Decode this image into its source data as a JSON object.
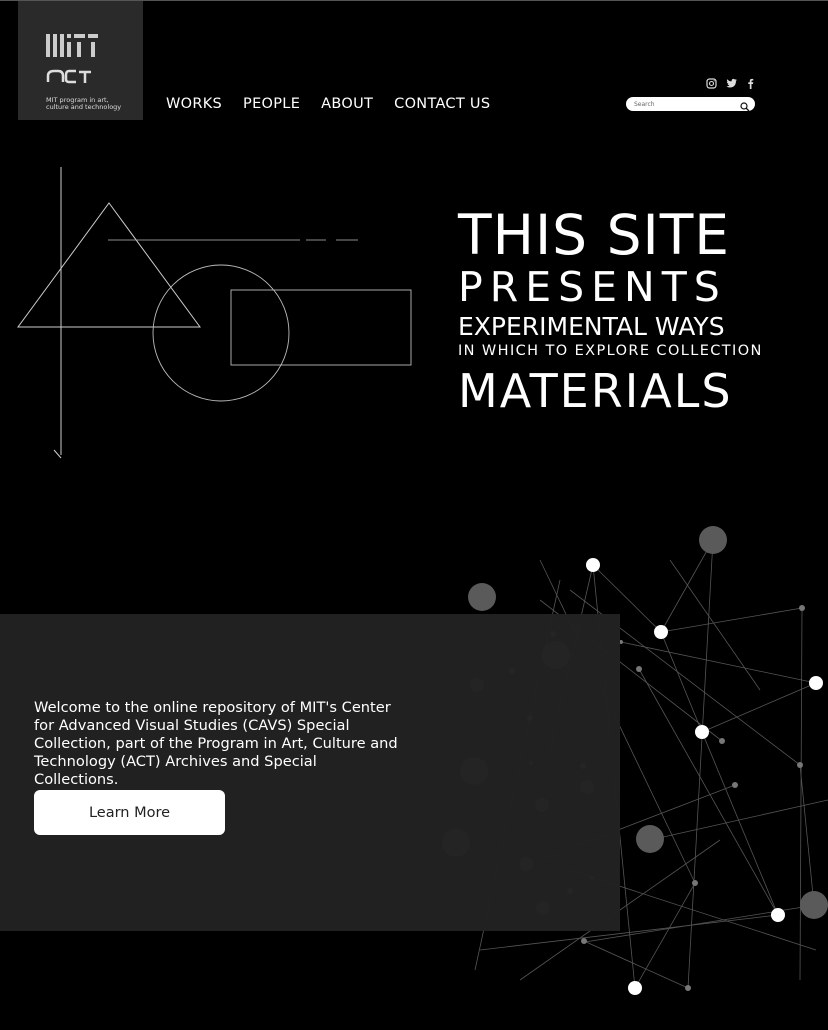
{
  "logo": {
    "subtitle": "MIT program in art,\nculture and technology"
  },
  "nav": [
    "WORKS",
    "PEOPLE",
    "ABOUT",
    "CONTACT US"
  ],
  "social": [
    "instagram-icon",
    "twitter-icon",
    "facebook-icon"
  ],
  "search": {
    "placeholder": "Search"
  },
  "hero": {
    "line1": "THIS SITE",
    "line2": "PRESENTS",
    "line3": "EXPERIMENTAL WAYS",
    "line4": "IN WHICH TO EXPLORE COLLECTION",
    "line5": "MATERIALS"
  },
  "intro": {
    "text": "Welcome to the online repository of MIT's Center for Advanced Visual Studies (CAVS) Special Collection, part of the Program in Art, Culture and Technology (ACT) Archives and Special Collections.",
    "button": "Learn More"
  }
}
